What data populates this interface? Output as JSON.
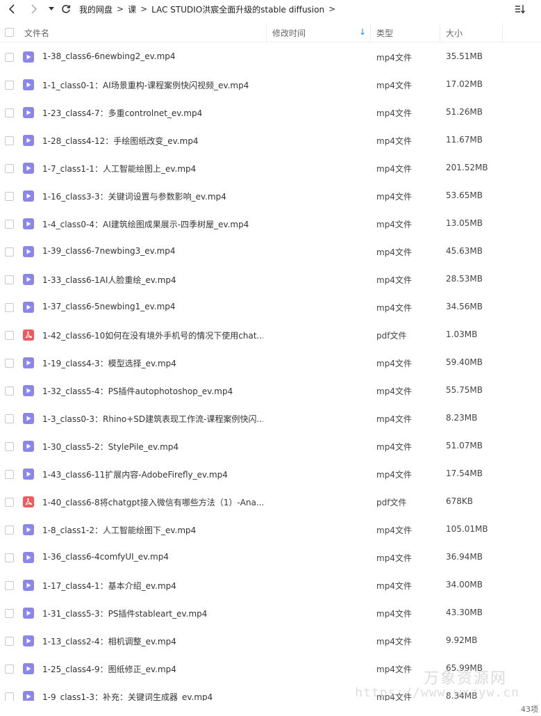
{
  "toolbar": {
    "back_icon": "chevron-left-icon",
    "forward_icon": "chevron-right-icon",
    "dropdown_icon": "caret-down-icon",
    "refresh_icon": "refresh-icon",
    "sort_icon": "sort-list-icon",
    "breadcrumb": [
      "我的网盘",
      "课",
      "LAC STUDIO洪宸全面升级的stable diffusion"
    ],
    "separator": ">"
  },
  "header": {
    "name": "文件名",
    "mtime": "修改时间",
    "sort_arrow": "↓",
    "type": "类型",
    "size": "大小"
  },
  "colors": {
    "video_icon": "#8b87ea",
    "pdf_icon": "#f1595b",
    "sort_accent": "#1e88e5"
  },
  "files": [
    {
      "name": "1-38_class6-6newbing2_ev.mp4",
      "type": "mp4文件",
      "size": "35.51MB",
      "icon": "video"
    },
    {
      "name": "1-1_class0-1：AI场景重构-课程案例快闪视频_ev.mp4",
      "type": "mp4文件",
      "size": "17.02MB",
      "icon": "video"
    },
    {
      "name": "1-23_class4-7：多重controlnet_ev.mp4",
      "type": "mp4文件",
      "size": "51.26MB",
      "icon": "video"
    },
    {
      "name": "1-28_class4-12：手绘图纸改变_ev.mp4",
      "type": "mp4文件",
      "size": "11.67MB",
      "icon": "video"
    },
    {
      "name": "1-7_class1-1：人工智能绘图上_ev.mp4",
      "type": "mp4文件",
      "size": "201.52MB",
      "icon": "video"
    },
    {
      "name": "1-16_class3-3：关键词设置与参数影响_ev.mp4",
      "type": "mp4文件",
      "size": "53.65MB",
      "icon": "video"
    },
    {
      "name": "1-4_class0-4：AI建筑绘图成果展示-四季树屋_ev.mp4",
      "type": "mp4文件",
      "size": "13.05MB",
      "icon": "video"
    },
    {
      "name": "1-39_class6-7newbing3_ev.mp4",
      "type": "mp4文件",
      "size": "45.63MB",
      "icon": "video"
    },
    {
      "name": "1-33_class6-1AI人脸重绘_ev.mp4",
      "type": "mp4文件",
      "size": "28.53MB",
      "icon": "video"
    },
    {
      "name": "1-37_class6-5newbing1_ev.mp4",
      "type": "mp4文件",
      "size": "34.56MB",
      "icon": "video"
    },
    {
      "name": "1-42_class6-10如何在没有境外手机号的情况下使用chat...",
      "type": "pdf文件",
      "size": "1.03MB",
      "icon": "pdf"
    },
    {
      "name": "1-19_class4-3：模型选择_ev.mp4",
      "type": "mp4文件",
      "size": "59.40MB",
      "icon": "video"
    },
    {
      "name": "1-32_class5-4：PS插件autophotoshop_ev.mp4",
      "type": "mp4文件",
      "size": "55.75MB",
      "icon": "video"
    },
    {
      "name": "1-3_class0-3：Rhino+SD建筑表现工作流-课程案例快闪...",
      "type": "mp4文件",
      "size": "8.23MB",
      "icon": "video"
    },
    {
      "name": "1-30_class5-2：StylePile_ev.mp4",
      "type": "mp4文件",
      "size": "51.07MB",
      "icon": "video"
    },
    {
      "name": "1-43_class6-11扩展内容-AdobeFirefly_ev.mp4",
      "type": "mp4文件",
      "size": "17.54MB",
      "icon": "video"
    },
    {
      "name": "1-40_class6-8将chatgpt接入微信有哪些方法（1）-Ana...",
      "type": "pdf文件",
      "size": "678KB",
      "icon": "pdf"
    },
    {
      "name": "1-8_class1-2：人工智能绘图下_ev.mp4",
      "type": "mp4文件",
      "size": "105.01MB",
      "icon": "video"
    },
    {
      "name": "1-36_class6-4comfyUI_ev.mp4",
      "type": "mp4文件",
      "size": "36.94MB",
      "icon": "video"
    },
    {
      "name": "1-17_class4-1：基本介绍_ev.mp4",
      "type": "mp4文件",
      "size": "34.00MB",
      "icon": "video"
    },
    {
      "name": "1-31_class5-3：PS插件stableart_ev.mp4",
      "type": "mp4文件",
      "size": "43.30MB",
      "icon": "video"
    },
    {
      "name": "1-13_class2-4：相机调整_ev.mp4",
      "type": "mp4文件",
      "size": "9.92MB",
      "icon": "video"
    },
    {
      "name": "1-25_class4-9：图纸修正_ev.mp4",
      "type": "mp4文件",
      "size": "65.99MB",
      "icon": "video"
    },
    {
      "name": "1-9_class1-3：补充：关键词生成器_ev.mp4",
      "type": "mp4文件",
      "size": "8.34MB",
      "icon": "video"
    }
  ],
  "watermark": {
    "line1": "万象资源网",
    "line2": "https://www.wxzyw.cn"
  },
  "status": {
    "item_count": "43项"
  }
}
